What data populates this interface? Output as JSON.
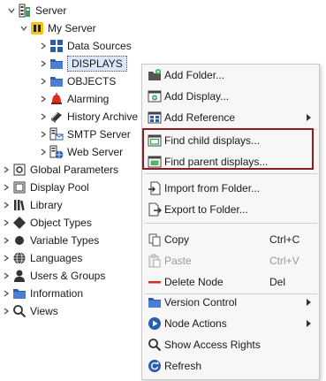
{
  "tree": {
    "server": "Server",
    "my_server": "My Server",
    "data_sources": "Data Sources",
    "displays": "DISPLAYS",
    "objects": "OBJECTS",
    "alarming": "Alarming",
    "history_archive": "History Archive",
    "smtp_server": "SMTP Server",
    "web_server": "Web Server",
    "global_parameters": "Global Parameters",
    "display_pool": "Display Pool",
    "library": "Library",
    "object_types": "Object Types",
    "variable_types": "Variable Types",
    "languages": "Languages",
    "users_groups": "Users & Groups",
    "information": "Information",
    "views": "Views"
  },
  "menu": {
    "add_folder": "Add Folder...",
    "add_display": "Add Display...",
    "add_reference": "Add Reference",
    "find_child": "Find child displays...",
    "find_parent": "Find parent displays...",
    "import_folder": "Import from Folder...",
    "export_folder": "Export to Folder...",
    "copy": "Copy",
    "copy_shortcut": "Ctrl+C",
    "paste": "Paste",
    "paste_shortcut": "Ctrl+V",
    "delete_node": "Delete Node",
    "delete_shortcut": "Del",
    "version_control": "Version Control",
    "node_actions": "Node Actions",
    "show_access_rights": "Show Access Rights",
    "refresh": "Refresh"
  },
  "colors": {
    "highlight_border": "#8b1e1e",
    "folder_blue": "#2a5db0",
    "selection_bg": "#dbe8f7"
  }
}
